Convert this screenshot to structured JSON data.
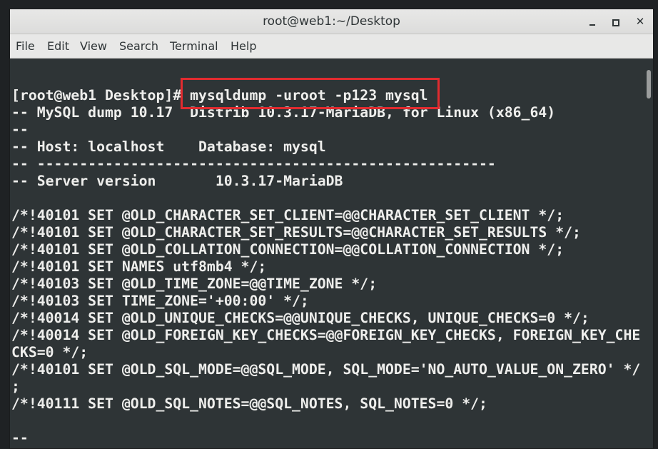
{
  "window": {
    "title": "root@web1:~/Desktop",
    "minimize_icon": "minimize-icon",
    "maximize_icon": "maximize-icon",
    "close_icon": "close-icon",
    "close_glyph": "✕"
  },
  "menubar": {
    "items": [
      "File",
      "Edit",
      "View",
      "Search",
      "Terminal",
      "Help"
    ]
  },
  "terminal": {
    "lines": [
      "",
      "[root@web1 Desktop]# mysqldump -uroot -p123 mysql",
      "-- MySQL dump 10.17  Distrib 10.3.17-MariaDB, for Linux (x86_64)",
      "--",
      "-- Host: localhost    Database: mysql",
      "-- ------------------------------------------------------",
      "-- Server version       10.3.17-MariaDB",
      "",
      "/*!40101 SET @OLD_CHARACTER_SET_CLIENT=@@CHARACTER_SET_CLIENT */;",
      "/*!40101 SET @OLD_CHARACTER_SET_RESULTS=@@CHARACTER_SET_RESULTS */;",
      "/*!40101 SET @OLD_COLLATION_CONNECTION=@@COLLATION_CONNECTION */;",
      "/*!40101 SET NAMES utf8mb4 */;",
      "/*!40103 SET @OLD_TIME_ZONE=@@TIME_ZONE */;",
      "/*!40103 SET TIME_ZONE='+00:00' */;",
      "/*!40014 SET @OLD_UNIQUE_CHECKS=@@UNIQUE_CHECKS, UNIQUE_CHECKS=0 */;",
      "/*!40014 SET @OLD_FOREIGN_KEY_CHECKS=@@FOREIGN_KEY_CHECKS, FOREIGN_KEY_CHE",
      "CKS=0 */;",
      "/*!40101 SET @OLD_SQL_MODE=@@SQL_MODE, SQL_MODE='NO_AUTO_VALUE_ON_ZERO' */",
      ";",
      "/*!40111 SET @OLD_SQL_NOTES=@@SQL_NOTES, SQL_NOTES=0 */;",
      "",
      "--"
    ],
    "highlighted_command": "mysqldump -uroot -p123 mysql",
    "highlight_color": "#e22b2f",
    "background": "#2e3436",
    "foreground": "#eeeeec"
  }
}
